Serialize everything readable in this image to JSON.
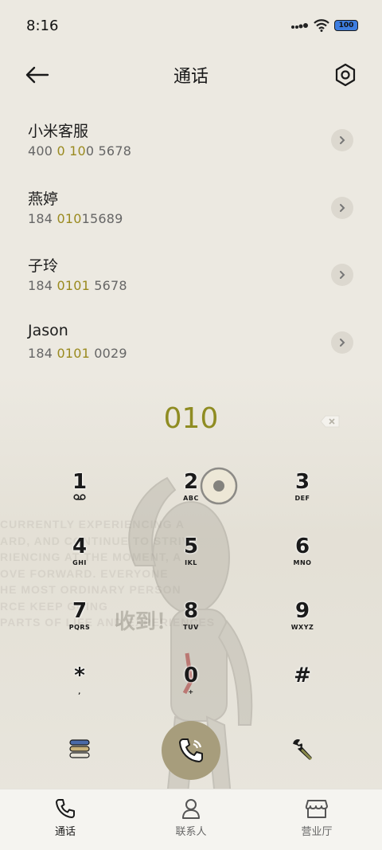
{
  "status_bar": {
    "time": "8:16",
    "battery": "100"
  },
  "header": {
    "title": "通话"
  },
  "contacts": [
    {
      "name": "小米客服",
      "number_parts": [
        "400 ",
        "0",
        " ",
        "10",
        "0 5678"
      ]
    },
    {
      "name": "燕婷",
      "number_parts": [
        "184 ",
        "010",
        "15689",
        "",
        ""
      ]
    },
    {
      "name": "子玲",
      "number_parts": [
        "184 ",
        "0101",
        " 5678",
        "",
        ""
      ]
    },
    {
      "name": "Jason",
      "number_parts": [
        "184 ",
        "0101",
        " 0029",
        "",
        ""
      ]
    }
  ],
  "dialer": {
    "number": "010"
  },
  "keypad": [
    {
      "digit": "1",
      "letters": ""
    },
    {
      "digit": "2",
      "letters": "ABC"
    },
    {
      "digit": "3",
      "letters": "DEF"
    },
    {
      "digit": "4",
      "letters": "GHI"
    },
    {
      "digit": "5",
      "letters": "IKL"
    },
    {
      "digit": "6",
      "letters": "MNO"
    },
    {
      "digit": "7",
      "letters": "PQRS"
    },
    {
      "digit": "8",
      "letters": "TUV"
    },
    {
      "digit": "9",
      "letters": "WXYZ"
    },
    {
      "digit": "*",
      "letters": ","
    },
    {
      "digit": "0",
      "letters": "+"
    },
    {
      "digit": "#",
      "letters": ""
    }
  ],
  "background": {
    "watermark": "收到！",
    "text_lines": [
      "CURRENTLY EXPERIENCING A",
      "ARD, AND CONTINUE TO STRIV",
      "RIENCING AT THE MOMENT, A",
      "OVE FORWARD. EVERYONE",
      "HE MOST ORDINARY PERSON",
      "RCE KEEP GOING",
      "PARTS OF LIFE AND EXPERIENCES"
    ]
  },
  "tabs": [
    {
      "label": "通话",
      "icon": "phone-icon",
      "active": true
    },
    {
      "label": "联系人",
      "icon": "person-icon",
      "active": false
    },
    {
      "label": "营业厅",
      "icon": "store-icon",
      "active": false
    }
  ],
  "colors": {
    "highlight": "#9a8a1f",
    "dial_number": "#8f8c22",
    "call_button": "#a79d7c",
    "background": "#ece9e1"
  }
}
